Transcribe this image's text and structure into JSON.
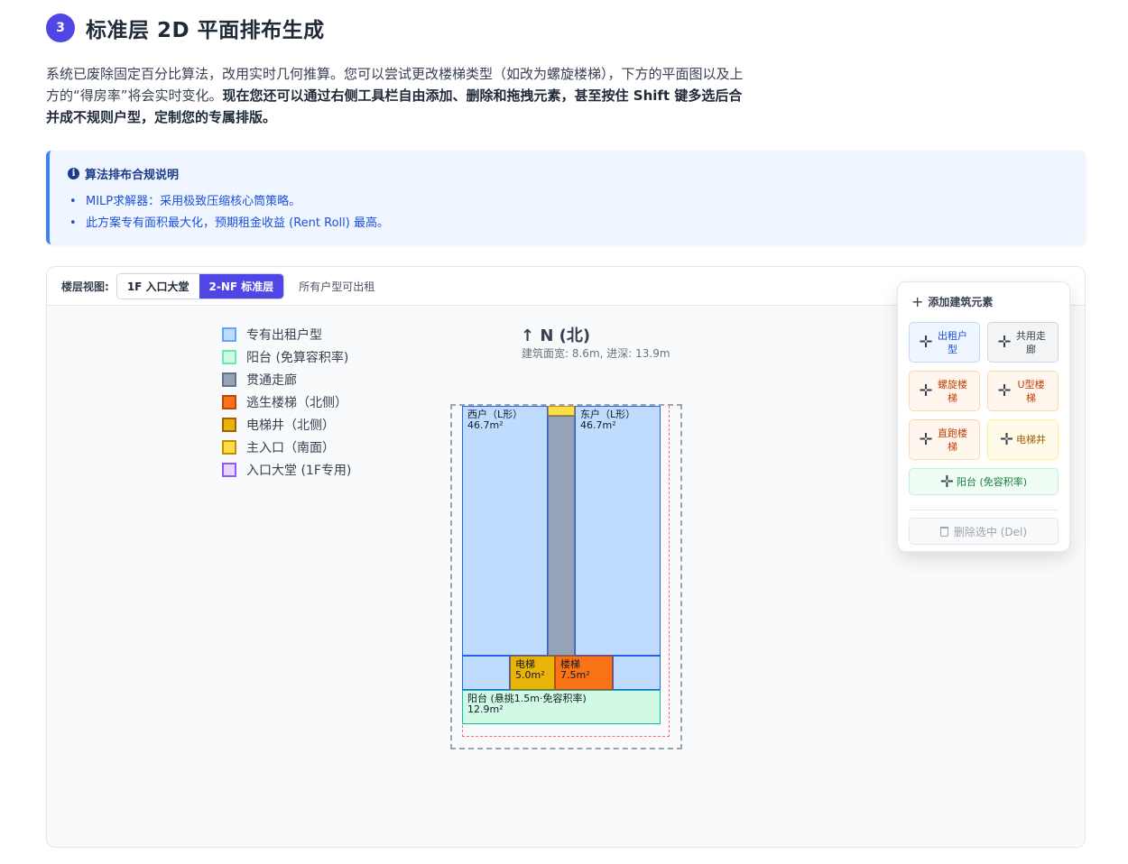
{
  "step": {
    "number": "3",
    "title": "标准层 2D 平面排布生成"
  },
  "intro": {
    "plain": "系统已废除固定百分比算法，改用实时几何推算。您可以尝试更改楼梯类型（如改为螺旋楼梯），下方的平面图以及上方的“得房率”将会实时变化。",
    "bold": "现在您还可以通过右侧工具栏自由添加、删除和拖拽元素，甚至按住 Shift 键多选后合并成不规则户型，定制您的专属排版。"
  },
  "info": {
    "title": "算法排布合规说明",
    "items": [
      "MILP求解器：采用极致压缩核心筒策略。",
      "此方案专有面积最大化，预期租金收益 (Rent Roll) 最高。"
    ]
  },
  "toolbar": {
    "label": "楼层视图:",
    "tabs": [
      "1F 入口大堂",
      "2-NF 标准层"
    ],
    "active_tab": 1,
    "note": "所有户型可出租"
  },
  "legend": [
    {
      "label": "专有出租户型",
      "fill": "#bfdbfe",
      "stroke": "#60a5fa"
    },
    {
      "label": "阳台 (免算容积率)",
      "fill": "#d1fae5",
      "stroke": "#6ee7b7"
    },
    {
      "label": "贯通走廊",
      "fill": "#94a3b8",
      "stroke": "#64748b"
    },
    {
      "label": "逃生楼梯（北侧）",
      "fill": "#f97316",
      "stroke": "#c2410c"
    },
    {
      "label": "电梯井（北侧）",
      "fill": "#eab308",
      "stroke": "#a16207"
    },
    {
      "label": "主入口（南面）",
      "fill": "#fde047",
      "stroke": "#ca8a04"
    },
    {
      "label": "入口大堂 (1F专用)",
      "fill": "#e9d5ff",
      "stroke": "#8b5cf6"
    }
  ],
  "compass": {
    "label": "↑ N (北)",
    "dims": "建筑面宽: 8.6m, 进深: 13.9m"
  },
  "plan": {
    "west_unit": {
      "name": "西户（L形）",
      "area": "46.7m²"
    },
    "east_unit": {
      "name": "东户（L形）",
      "area": "46.7m²"
    },
    "elevator": {
      "name": "电梯",
      "area": "5.0m²"
    },
    "stair": {
      "name": "楼梯",
      "area": "7.5m²"
    },
    "balcony": {
      "name": "阳台 (悬挑1.5m·免容积率)",
      "area": "12.9m²"
    }
  },
  "palette": {
    "title": "添加建筑元素",
    "buttons": [
      "出租户型",
      "共用走廊",
      "螺旋楼梯",
      "U型楼梯",
      "直跑楼梯",
      "电梯井",
      "阳台 (免容积率)"
    ],
    "delete": "删除选中 (Del)"
  },
  "colors": {
    "accent": "#4f46e5",
    "info_border": "#3b82f6"
  }
}
